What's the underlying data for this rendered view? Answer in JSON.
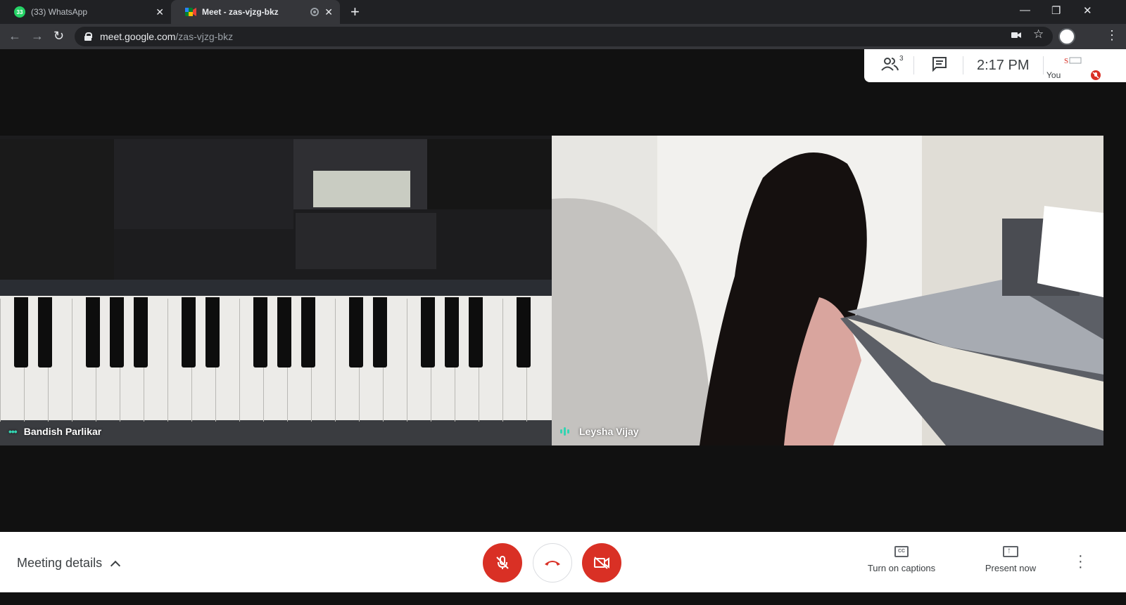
{
  "browser": {
    "tabs": [
      {
        "title": "(33) WhatsApp",
        "badge": "33",
        "active": false
      },
      {
        "title": "Meet - zas-vjzg-bkz",
        "active": true
      }
    ],
    "new_tab_icon": "+",
    "url_host": "meet.google.com",
    "url_path": "/zas-vjzg-bkz"
  },
  "meet": {
    "top_panel": {
      "participants_count": "3",
      "time": "2:17  PM",
      "self_label": "You"
    },
    "tiles": [
      {
        "name": "Bandish Parlikar",
        "indicator": "dots"
      },
      {
        "name": "Leysha Vijay",
        "indicator": "bars"
      }
    ],
    "bottom_bar": {
      "meeting_details_label": "Meeting details",
      "captions_label": "Turn on captions",
      "present_label": "Present now",
      "cc_text": "CC"
    },
    "colors": {
      "accent_red": "#d93025",
      "teal": "#34d4b2",
      "dark_bg": "#111111"
    }
  }
}
